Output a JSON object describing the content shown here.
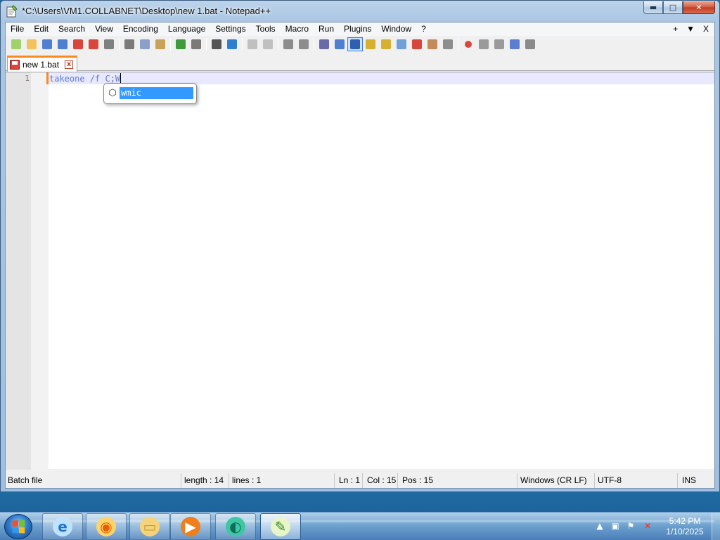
{
  "window": {
    "title": "*C:\\Users\\VM1.COLLABNET\\Desktop\\new 1.bat - Notepad++",
    "minimize_glyph": "▬",
    "maximize_glyph": "□",
    "close_glyph": "✕"
  },
  "menu": {
    "items": [
      "File",
      "Edit",
      "Search",
      "View",
      "Encoding",
      "Language",
      "Settings",
      "Tools",
      "Macro",
      "Run",
      "Plugins",
      "Window",
      "?"
    ],
    "right": [
      "+",
      "▼",
      "X"
    ]
  },
  "toolbar": {
    "icons": [
      "new-file-icon",
      "open-file-icon",
      "save-icon",
      "save-all-icon",
      "close-icon",
      "close-all-icon",
      "print-icon",
      "cut-icon",
      "copy-icon",
      "paste-icon",
      "undo-icon",
      "redo-icon",
      "find-icon",
      "replace-icon",
      "zoom-in-icon",
      "zoom-out-icon",
      "sync-vertical-icon",
      "sync-horizontal-icon",
      "word-wrap-icon",
      "show-all-chars-icon",
      "indent-guide-icon",
      "udl-icon",
      "doc-map-icon",
      "doc-list-icon",
      "function-list-icon",
      "folder-workspace-icon",
      "monitoring-icon",
      "record-macro-icon",
      "stop-macro-icon",
      "play-macro-icon",
      "run-multiple-macro-icon",
      "save-macro-icon"
    ],
    "active_index": 20
  },
  "tab": {
    "label": "new 1.bat",
    "close_glyph": "x",
    "accent": "#fa8a1e"
  },
  "editor": {
    "line_number": "1",
    "line_text": "takeone /f C;W",
    "syntax_color": "#5f7ec8"
  },
  "autocomplete": {
    "icon_glyph": "⬡",
    "suggestion": "wmic",
    "highlight_color": "#3399ff"
  },
  "status": {
    "file_type": "Batch file",
    "length": "length : 14",
    "lines": "lines : 1",
    "ln": "Ln : 1",
    "col": "Col : 15",
    "pos": "Pos : 15",
    "eol": "Windows (CR LF)",
    "encoding": "UTF-8",
    "mode": "INS"
  },
  "taskbar": {
    "time": "5:42 PM",
    "date": "1/10/2025",
    "apps": [
      {
        "name": "internet-explorer-icon",
        "glyph": "e",
        "color": "#1f74d1",
        "bg": "#bfe3ff"
      },
      {
        "name": "firefox-icon",
        "glyph": "◉",
        "color": "#e66000",
        "bg": "#ffd26a"
      },
      {
        "name": "file-explorer-icon",
        "glyph": "▭",
        "color": "#c99a2e",
        "bg": "#f5d37a"
      },
      {
        "name": "media-player-icon",
        "glyph": "▶",
        "color": "#ffffff",
        "bg": "#f07e1a"
      },
      {
        "name": "chat-app-icon",
        "glyph": "◐",
        "color": "#0f6b5c",
        "bg": "#3fc7a4"
      },
      {
        "name": "notepad-plus-plus-icon",
        "glyph": "✎",
        "color": "#2f8a22",
        "bg": "#e8f5c8"
      }
    ],
    "tray_icons": [
      "chevron-up-icon",
      "network-icon",
      "action-center-flag-icon",
      "volume-muted-icon"
    ],
    "tray_glyphs": [
      "▲",
      "▣",
      "⚑",
      "✕"
    ]
  }
}
